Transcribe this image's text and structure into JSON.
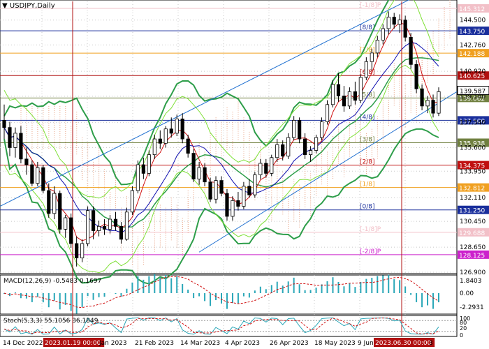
{
  "symbol_title": "USDJPY,Daily",
  "colors": {
    "grid": "#c8c8c8",
    "bull": "#ffffff",
    "bear": "#000000",
    "bb": "#2e9e4a",
    "envelope": "#7fe038",
    "ema_fast": "#d01010",
    "ema_slow": "#1010b0",
    "trend": "#1e6fd0",
    "ichimoku": "#e8a080",
    "vline": "#b01010",
    "macd_hist": "#2aa7b8",
    "macd_signal": "#d01010",
    "stoch_main": "#2aa7b8",
    "stoch_signal": "#d01010"
  },
  "murray_levels": [
    {
      "label": "[-1/8]P",
      "price": "145.312",
      "color": "#f2c0c8",
      "line": "#f2c0c8"
    },
    {
      "label": "[8/8]",
      "price": "143.750",
      "color": "#1a2f9c",
      "line": "#1a2f9c"
    },
    {
      "label": "[7/8]",
      "price": "142.188",
      "color": "#f0a020",
      "line": "#f0a020"
    },
    {
      "label": "[6/8]",
      "price": "140.625",
      "color": "#b01010",
      "line": "#b01010"
    },
    {
      "label": "[5/8]",
      "price": "139.062",
      "color": "#708040",
      "line": "#708040"
    },
    {
      "label": "[4/8]",
      "price": "137.500",
      "color": "#1a2f9c",
      "line": "#1a2f9c"
    },
    {
      "label": "[3/8]",
      "price": "135.938",
      "color": "#708040",
      "line": "#708040"
    },
    {
      "label": "[2/8]",
      "price": "134.375",
      "color": "#c01010",
      "line": "#c01010"
    },
    {
      "label": "[1/8]",
      "price": "132.812",
      "color": "#f0a020",
      "line": "#f0a020"
    },
    {
      "label": "[0/8]",
      "price": "131.250",
      "color": "#1a2f9c",
      "line": "#1a2f9c"
    },
    {
      "label": "[-1/8]P",
      "price": "129.688",
      "color": "#f2c0c8",
      "line": "#f2c0c8"
    },
    {
      "label": "[-2/8]P",
      "price": "128.125",
      "color": "#cc20cc",
      "line": "#cc20cc"
    }
  ],
  "price_ticks": [
    "144.500",
    "142.760",
    "140.920",
    "139.180",
    "137.340",
    "135.600",
    "133.950",
    "132.110",
    "130.450",
    "128.650",
    "126.900"
  ],
  "current_price": "139.587",
  "macd": {
    "label": "MACD(12,26,9) -0.5483 0.1697",
    "ticks": [
      "1.8403",
      "0.00",
      "-2.2931"
    ]
  },
  "stoch": {
    "label": "Stoch(5,3,3) 55.1056 36.1849",
    "ticks": [
      "100",
      "80",
      "20",
      "0"
    ]
  },
  "date_axis": [
    "14 Dec 2022",
    "2023.01.19 00:00",
    "Jan 2023",
    "21 Feb 2023",
    "14 Mar 2023",
    "4 Apr 2023",
    "26 Apr 2023",
    "18 May 2023",
    "9 Jun",
    "2023.06.30 00:00",
    "3"
  ],
  "chart_data": {
    "type": "candlestick",
    "title": "USDJPY,Daily",
    "ohlc": [
      [
        137.5,
        138.6,
        136.2,
        137.0
      ],
      [
        137.0,
        137.4,
        135.0,
        135.6
      ],
      [
        135.6,
        137.0,
        134.9,
        136.6
      ],
      [
        136.6,
        137.1,
        134.5,
        134.8
      ],
      [
        134.8,
        135.6,
        133.7,
        134.4
      ],
      [
        134.4,
        134.7,
        132.9,
        133.1
      ],
      [
        133.1,
        134.6,
        132.9,
        134.2
      ],
      [
        134.2,
        134.4,
        132.4,
        132.6
      ],
      [
        132.6,
        133.1,
        130.7,
        131.0
      ],
      [
        131.0,
        132.9,
        130.6,
        132.4
      ],
      [
        132.4,
        132.6,
        129.6,
        129.9
      ],
      [
        129.9,
        130.9,
        129.3,
        130.7
      ],
      [
        130.7,
        131.0,
        128.6,
        128.9
      ],
      [
        128.9,
        129.4,
        127.3,
        127.9
      ],
      [
        127.9,
        129.2,
        127.6,
        128.9
      ],
      [
        128.9,
        131.5,
        128.7,
        131.2
      ],
      [
        131.2,
        131.5,
        129.2,
        129.8
      ],
      [
        129.8,
        130.5,
        129.4,
        130.1
      ],
      [
        130.1,
        130.6,
        129.5,
        129.9
      ],
      [
        129.9,
        130.9,
        129.6,
        130.6
      ],
      [
        130.6,
        131.1,
        129.8,
        130.1
      ],
      [
        130.1,
        130.4,
        128.9,
        129.2
      ],
      [
        129.2,
        131.4,
        129.1,
        131.1
      ],
      [
        131.1,
        132.9,
        130.9,
        132.6
      ],
      [
        132.6,
        134.7,
        132.4,
        134.4
      ],
      [
        134.4,
        134.9,
        133.4,
        133.8
      ],
      [
        133.8,
        135.4,
        133.6,
        135.1
      ],
      [
        135.1,
        136.5,
        134.8,
        136.2
      ],
      [
        136.2,
        136.8,
        135.5,
        135.9
      ],
      [
        135.9,
        137.1,
        135.6,
        136.9
      ],
      [
        136.9,
        137.7,
        136.3,
        136.6
      ],
      [
        136.6,
        137.9,
        136.4,
        137.6
      ],
      [
        137.6,
        138.0,
        135.9,
        136.2
      ],
      [
        136.2,
        136.5,
        134.9,
        135.2
      ],
      [
        135.2,
        135.5,
        133.2,
        133.4
      ],
      [
        133.4,
        134.6,
        133.0,
        134.2
      ],
      [
        134.2,
        134.5,
        132.9,
        133.2
      ],
      [
        133.2,
        133.5,
        131.8,
        132.0
      ],
      [
        132.0,
        133.6,
        131.7,
        133.3
      ],
      [
        133.3,
        133.6,
        132.2,
        132.4
      ],
      [
        132.4,
        132.7,
        130.5,
        130.8
      ],
      [
        130.8,
        132.2,
        130.5,
        131.9
      ],
      [
        131.9,
        132.5,
        131.2,
        131.5
      ],
      [
        131.5,
        133.2,
        131.3,
        132.9
      ],
      [
        132.9,
        133.4,
        132.1,
        132.3
      ],
      [
        132.3,
        133.9,
        132.1,
        133.7
      ],
      [
        133.7,
        134.8,
        133.4,
        134.5
      ],
      [
        134.5,
        134.8,
        133.5,
        133.8
      ],
      [
        133.8,
        135.1,
        133.6,
        134.9
      ],
      [
        134.9,
        136.2,
        134.6,
        135.8
      ],
      [
        135.8,
        136.1,
        134.7,
        135.0
      ],
      [
        135.0,
        136.6,
        134.8,
        136.3
      ],
      [
        136.3,
        137.8,
        136.1,
        137.5
      ],
      [
        137.5,
        137.7,
        135.9,
        136.2
      ],
      [
        136.2,
        136.6,
        134.8,
        135.1
      ],
      [
        135.1,
        135.7,
        134.6,
        135.4
      ],
      [
        135.4,
        136.5,
        135.2,
        136.3
      ],
      [
        136.3,
        137.7,
        136.1,
        137.4
      ],
      [
        137.4,
        138.9,
        137.2,
        138.6
      ],
      [
        138.6,
        140.3,
        138.4,
        140.0
      ],
      [
        140.0,
        140.8,
        138.8,
        139.2
      ],
      [
        139.2,
        139.9,
        138.1,
        138.5
      ],
      [
        138.5,
        139.8,
        138.3,
        139.5
      ],
      [
        139.5,
        140.2,
        138.6,
        138.9
      ],
      [
        138.9,
        140.7,
        138.7,
        140.5
      ],
      [
        140.5,
        141.9,
        140.3,
        141.6
      ],
      [
        141.6,
        142.5,
        141.0,
        142.2
      ],
      [
        142.2,
        143.4,
        141.9,
        143.1
      ],
      [
        143.1,
        144.2,
        142.8,
        143.9
      ],
      [
        143.9,
        145.1,
        143.5,
        144.7
      ],
      [
        144.7,
        145.0,
        143.9,
        144.2
      ],
      [
        144.2,
        144.9,
        143.6,
        144.5
      ],
      [
        144.5,
        144.8,
        143.0,
        143.3
      ],
      [
        143.3,
        143.6,
        141.1,
        141.4
      ],
      [
        141.4,
        141.7,
        139.4,
        139.7
      ],
      [
        139.7,
        140.0,
        138.2,
        138.5
      ],
      [
        138.5,
        139.2,
        138.0,
        138.9
      ],
      [
        138.9,
        139.3,
        137.7,
        138.0
      ],
      [
        138.0,
        139.8,
        137.8,
        139.5
      ]
    ],
    "ylim": [
      126.9,
      145.8
    ]
  }
}
